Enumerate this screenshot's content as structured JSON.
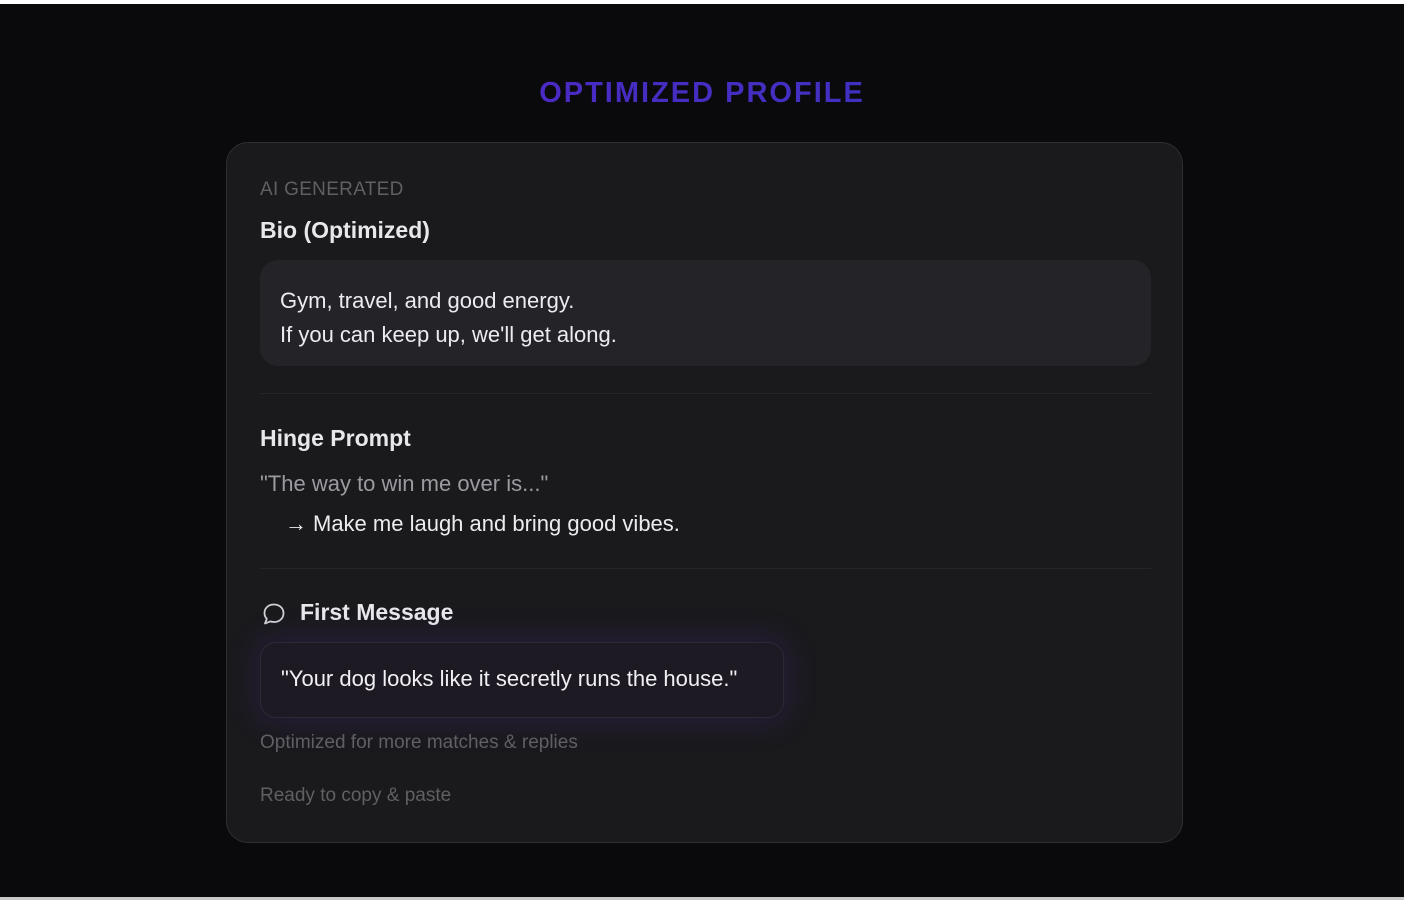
{
  "header": {
    "title": "OPTIMIZED PROFILE"
  },
  "card": {
    "eyebrow": "AI GENERATED",
    "bio": {
      "title": "Bio (Optimized)",
      "lines": [
        "Gym, travel, and good energy.",
        "If you can keep up, we'll get along."
      ]
    },
    "hinge_prompt": {
      "title": "Hinge Prompt",
      "question": "\"The way to win me over is...\"",
      "arrow": "→",
      "answer": "Make me laugh and bring good vibes."
    },
    "first_message": {
      "icon": "chat-bubble-icon",
      "title": "First Message",
      "message": "\"Your dog looks like it secretly runs the house.\""
    },
    "footer": {
      "note": "Optimized for more matches & replies",
      "status": "Ready to copy & paste"
    }
  },
  "colors": {
    "background": "#0a0a0c",
    "card": "#1a1a1d",
    "title_gradient_start": "#5b1fc7",
    "title_gradient_end": "#2f3cbd",
    "text_primary": "#ececf0",
    "text_muted": "#5f5f64"
  }
}
